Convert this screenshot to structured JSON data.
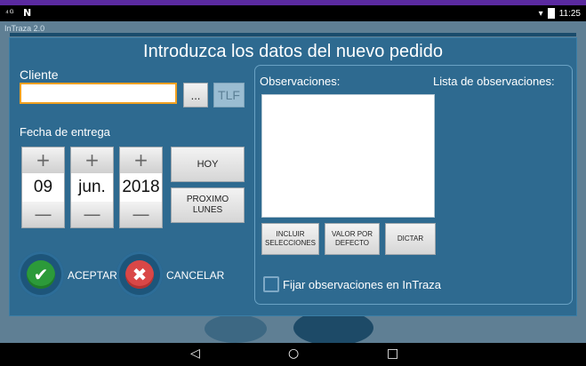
{
  "statusbar": {
    "signal_text": "⁴ᴳ",
    "notification_icon": "N",
    "clock": "11:25"
  },
  "app": {
    "title": "InTraza 2.0"
  },
  "dialog": {
    "title": "Introduzca los datos del nuevo pedido",
    "cliente": {
      "label": "Cliente",
      "value": "",
      "browse_label": "...",
      "tlf_label": "TLF"
    },
    "fecha": {
      "label": "Fecha de entrega",
      "day": "09",
      "month": "jun.",
      "year": "2018",
      "plus": "+",
      "minus": "—",
      "hoy_label": "HOY",
      "proximo_lunes_label": "PROXIMO LUNES"
    },
    "aceptar_label": "ACEPTAR",
    "cancelar_label": "CANCELAR",
    "observaciones_label": "Observaciones:",
    "lista_observaciones_label": "Lista de observaciones:",
    "observaciones_value": "",
    "incluir_label": "INCLUIR SELECCIONES",
    "valor_defecto_label": "VALOR POR DEFECTO",
    "dictar_label": "DICTAR",
    "fijar_label": "Fijar observaciones en InTraza",
    "fijar_checked": false
  },
  "navbar": {
    "back": "◁",
    "home": "○",
    "recents": "□"
  },
  "colors": {
    "dialog": "#2e6a90",
    "accent_focus": "#f0a020",
    "ok": "#2c9a3a",
    "cancel": "#d94747"
  }
}
